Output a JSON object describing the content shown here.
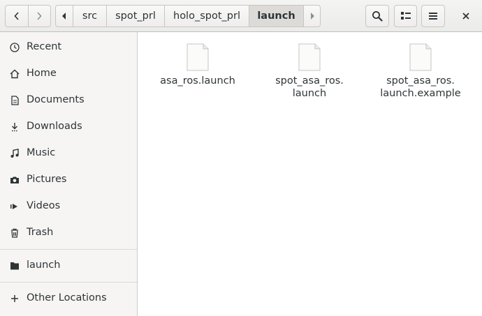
{
  "header": {
    "back_icon": "go-previous-icon",
    "forward_icon": "go-next-icon",
    "path_left_icon": "pan-start-icon",
    "path_right_icon": "pan-end-icon",
    "path": [
      "src",
      "spot_prl",
      "holo_spot_prl",
      "launch"
    ],
    "active_segment": "launch",
    "search_icon": "search-icon",
    "view_icon": "list-view-icon",
    "menu_icon": "hamburger-menu-icon",
    "close_icon": "close-icon"
  },
  "sidebar": {
    "items": [
      {
        "label": "Recent",
        "icon": "recent-clock-icon"
      },
      {
        "label": "Home",
        "icon": "home-icon"
      },
      {
        "label": "Documents",
        "icon": "documents-icon"
      },
      {
        "label": "Downloads",
        "icon": "downloads-icon"
      },
      {
        "label": "Music",
        "icon": "music-icon"
      },
      {
        "label": "Pictures",
        "icon": "pictures-camera-icon"
      },
      {
        "label": "Videos",
        "icon": "videos-icon"
      },
      {
        "label": "Trash",
        "icon": "trash-icon"
      }
    ],
    "bookmarks": [
      {
        "label": "launch",
        "icon": "folder-icon"
      }
    ],
    "other_locations": {
      "label": "Other Locations",
      "icon": "plus-icon"
    }
  },
  "files": [
    {
      "name_line1": "asa_ros.launch",
      "name_line2": "",
      "icon": "text-file-icon"
    },
    {
      "name_line1": "spot_asa_ros.",
      "name_line2": "launch",
      "icon": "text-file-icon"
    },
    {
      "name_line1": "spot_asa_ros.",
      "name_line2": "launch.example",
      "icon": "text-file-icon"
    }
  ]
}
